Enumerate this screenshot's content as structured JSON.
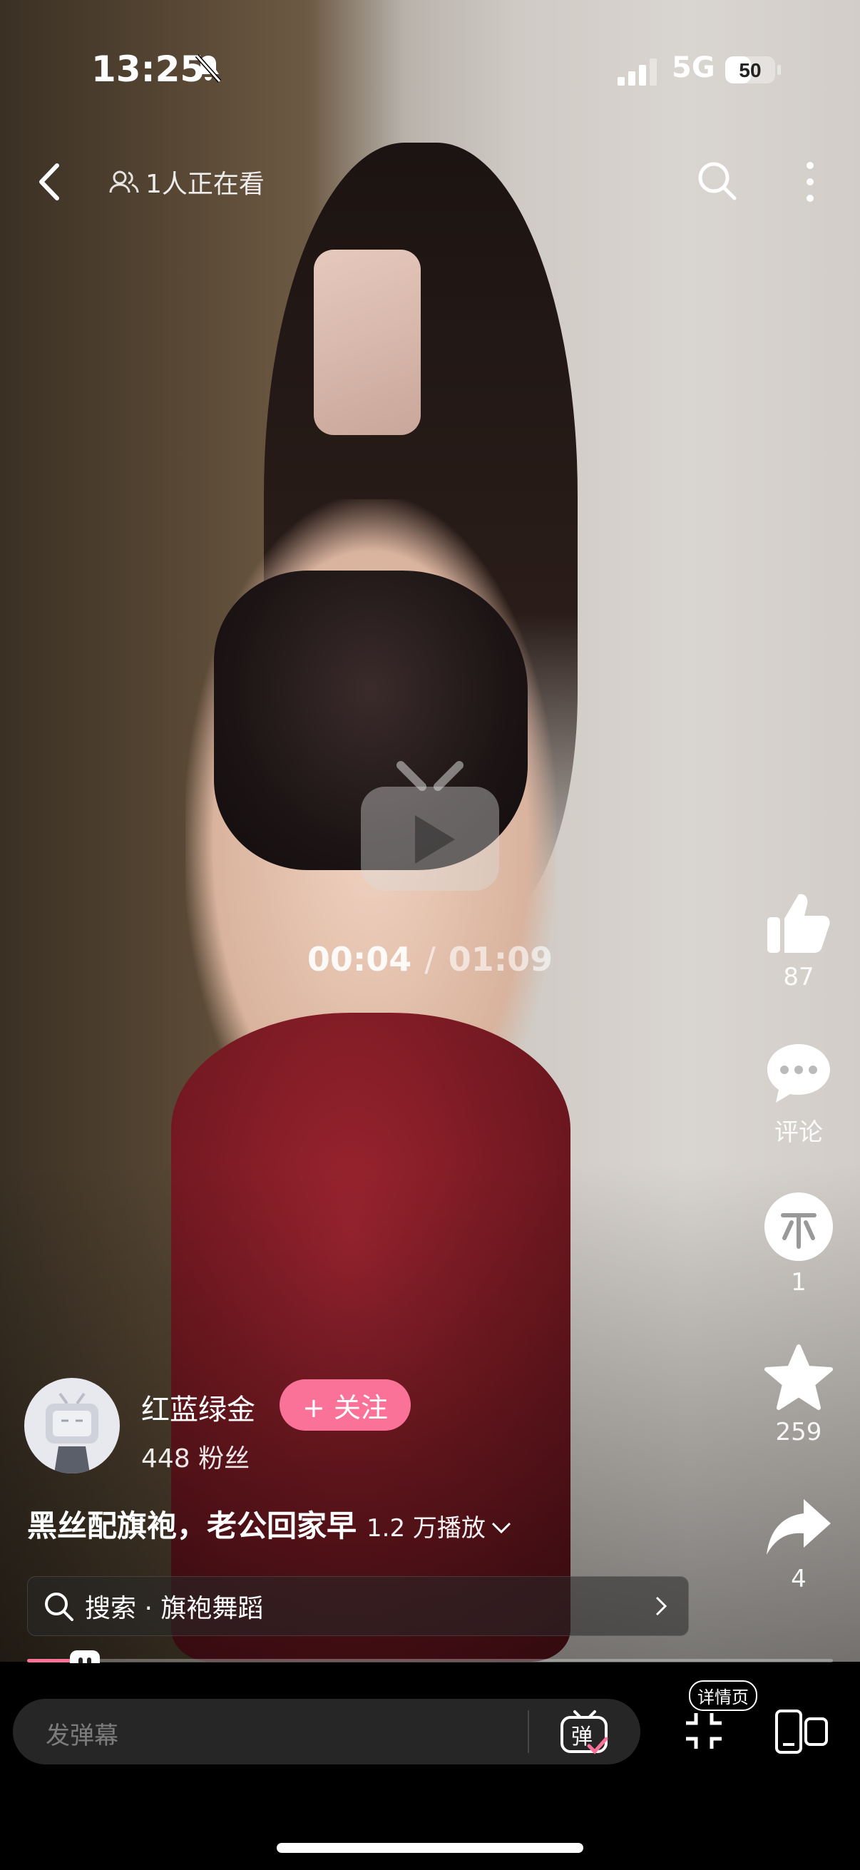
{
  "status_bar": {
    "time": "13:25",
    "network": "5G",
    "battery": "50"
  },
  "top_nav": {
    "watching": "1人正在看"
  },
  "player": {
    "current_time": "00:04",
    "separator": "/",
    "total_time": "01:09",
    "progress": 0.06
  },
  "actions": {
    "like_count": "87",
    "comment_label": "评论",
    "coin_count": "1",
    "favorite_count": "259",
    "share_count": "4"
  },
  "author": {
    "name": "红蓝绿金",
    "fans": "448 粉丝",
    "follow_label": "+ 关注"
  },
  "video": {
    "title": "黑丝配旗袍，老公回家早",
    "plays": "1.2 万播放"
  },
  "search": {
    "label": "搜索 · 旗袍舞蹈"
  },
  "bottom": {
    "danmaku_placeholder": "发弹幕",
    "danmaku_icon_text": "弹",
    "detail_label": "详情页"
  },
  "colors": {
    "accent": "#fb7299"
  }
}
